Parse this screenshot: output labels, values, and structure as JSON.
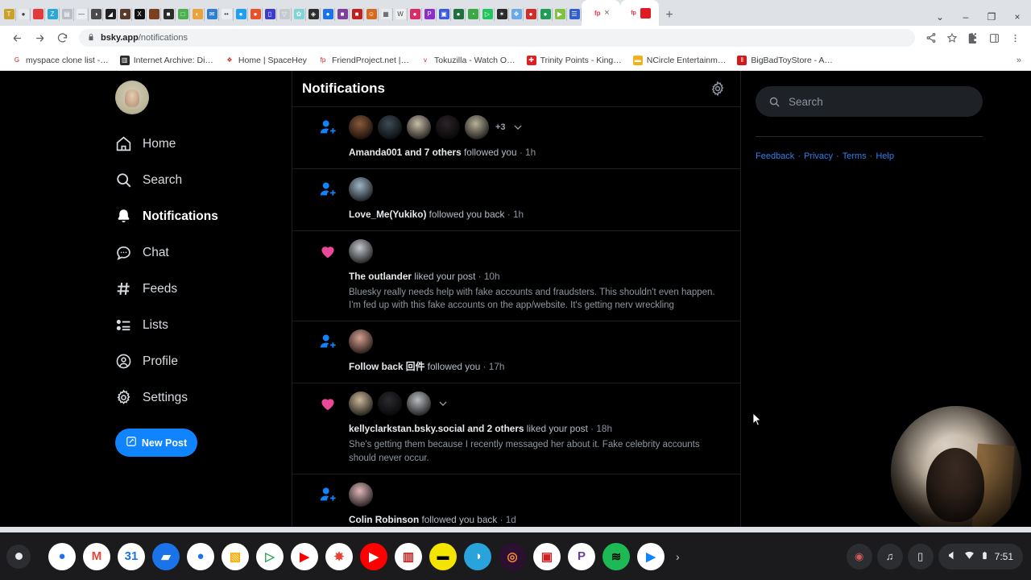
{
  "browser": {
    "url_host": "bsky.app",
    "url_path": "/notifications",
    "lock_icon": "lock-icon",
    "back_icon": "back-arrow-icon",
    "forward_icon": "forward-arrow-icon",
    "reload_icon": "reload-icon",
    "share_icon": "share-icon",
    "bookmark_icon": "star-icon",
    "extensions_icon": "puzzle-piece-icon",
    "sidepanel_icon": "side-panel-icon",
    "menu_icon": "three-dot-menu-icon",
    "newtab_label": "+",
    "tabsearch_label": "⌄",
    "minimize_label": "–",
    "maximize_label": "❐",
    "close_label": "×",
    "activetab_close": "×",
    "tab_favicons": [
      {
        "name": "tab-1",
        "color": "#c9a227",
        "glyph": "T"
      },
      {
        "name": "tab-2",
        "color": "#e8eaed",
        "glyph": "●"
      },
      {
        "name": "tab-3",
        "color": "#e23b3b",
        "glyph": ""
      },
      {
        "name": "tab-4",
        "color": "#2aa7d4",
        "glyph": "Z"
      },
      {
        "name": "tab-5",
        "color": "#b9bdc4",
        "glyph": "▤"
      },
      {
        "name": "tab-6",
        "color": "#eceff1",
        "glyph": "—"
      },
      {
        "name": "tab-7",
        "color": "#4a4a4a",
        "glyph": "◑"
      },
      {
        "name": "tab-8",
        "color": "#1f1f1f",
        "glyph": "◢"
      },
      {
        "name": "tab-9",
        "color": "#5a3a2a",
        "glyph": "●"
      },
      {
        "name": "tab-10",
        "color": "#111111",
        "glyph": "X"
      },
      {
        "name": "tab-11",
        "color": "#7a4020",
        "glyph": ""
      },
      {
        "name": "tab-12",
        "color": "#2b2b2b",
        "glyph": "■"
      },
      {
        "name": "tab-13",
        "color": "#4caf50",
        "glyph": "□"
      },
      {
        "name": "tab-14",
        "color": "#e8a33d",
        "glyph": "◐"
      },
      {
        "name": "tab-15",
        "color": "#2f7fd1",
        "glyph": "✉"
      },
      {
        "name": "tab-16",
        "color": "#eceff1",
        "glyph": "••"
      },
      {
        "name": "tab-17",
        "color": "#1da0f2",
        "glyph": "●"
      },
      {
        "name": "tab-18",
        "color": "#e8522b",
        "glyph": "●"
      },
      {
        "name": "tab-19",
        "color": "#3b3bcc",
        "glyph": "▯"
      },
      {
        "name": "tab-20",
        "color": "#c5cad1",
        "glyph": "▽"
      },
      {
        "name": "tab-21",
        "color": "#7fd4d4",
        "glyph": "✿"
      },
      {
        "name": "tab-22",
        "color": "#2e2e2e",
        "glyph": "◈"
      },
      {
        "name": "tab-23",
        "color": "#1a73e8",
        "glyph": "●"
      },
      {
        "name": "tab-24",
        "color": "#7e3f9d",
        "glyph": "■"
      },
      {
        "name": "tab-25",
        "color": "#c02020",
        "glyph": "■"
      },
      {
        "name": "tab-26",
        "color": "#d46a1f",
        "glyph": "☺"
      },
      {
        "name": "tab-27",
        "color": "#e8eaed",
        "glyph": "▦"
      },
      {
        "name": "tab-28",
        "color": "#f0f0f0",
        "glyph": "W"
      },
      {
        "name": "tab-29",
        "color": "#d92b6a",
        "glyph": "●"
      },
      {
        "name": "tab-30",
        "color": "#8b2fc9",
        "glyph": "P"
      },
      {
        "name": "tab-31",
        "color": "#3b5bdb",
        "glyph": "▣"
      },
      {
        "name": "tab-32",
        "color": "#1f6f3f",
        "glyph": "●"
      },
      {
        "name": "tab-33",
        "color": "#39a845",
        "glyph": "◔"
      },
      {
        "name": "tab-34",
        "color": "#22c55e",
        "glyph": "▷"
      },
      {
        "name": "tab-35",
        "color": "#2b2b2b",
        "glyph": "✶"
      },
      {
        "name": "tab-36",
        "color": "#6aa9e9",
        "glyph": "❖"
      },
      {
        "name": "tab-37",
        "color": "#d12b2b",
        "glyph": "●"
      },
      {
        "name": "tab-38",
        "color": "#1f9d55",
        "glyph": "●"
      },
      {
        "name": "tab-39",
        "color": "#7fc241",
        "glyph": "▶"
      },
      {
        "name": "tab-40",
        "color": "#2f5fd1",
        "glyph": "☰"
      }
    ],
    "active_tab_favicon": {
      "name": "friendproject-favicon",
      "color": "#e8344e",
      "glyph": "fp"
    },
    "active_tab_favicon2": {
      "name": "bluesky-tab-favicon",
      "color": "#e01b24",
      "glyph": "□"
    },
    "bookmarks": [
      {
        "name": "bookmark-myspace-clone-list",
        "label": "myspace clone list -…",
        "color": "#ffffff",
        "glyph": "G"
      },
      {
        "name": "bookmark-internet-archive",
        "label": "Internet Archive: Di…",
        "color": "#2b2b2b",
        "glyph": "▥"
      },
      {
        "name": "bookmark-spacehey",
        "label": "Home | SpaceHey",
        "color": "#ffffff",
        "glyph": "❖"
      },
      {
        "name": "bookmark-friendproject",
        "label": "FriendProject.net |…",
        "color": "#ffffff",
        "glyph": "fp"
      },
      {
        "name": "bookmark-tokuzilla",
        "label": "Tokuzilla - Watch O…",
        "color": "#ffffff",
        "glyph": "ᴠ"
      },
      {
        "name": "bookmark-trinity-points",
        "label": "Trinity Points - King…",
        "color": "#e02020",
        "glyph": "✚"
      },
      {
        "name": "bookmark-ncircle",
        "label": "NCircle Entertainm…",
        "color": "#f2b01e",
        "glyph": "▬"
      },
      {
        "name": "bookmark-bigbadtoystore",
        "label": "BigBadToyStore - A…",
        "color": "#cf1b1b",
        "glyph": "‖"
      }
    ],
    "bookmarks_overflow": "»"
  },
  "sidebar": {
    "avatar_name": "profile-avatar",
    "items": [
      {
        "label": "Home",
        "icon": "home-icon",
        "active": false
      },
      {
        "label": "Search",
        "icon": "search-icon",
        "active": false
      },
      {
        "label": "Notifications",
        "icon": "bell-icon",
        "active": true
      },
      {
        "label": "Chat",
        "icon": "chat-bubble-icon",
        "active": false
      },
      {
        "label": "Feeds",
        "icon": "hashtag-icon",
        "active": false
      },
      {
        "label": "Lists",
        "icon": "list-icon",
        "active": false
      },
      {
        "label": "Profile",
        "icon": "user-circle-icon",
        "active": false
      },
      {
        "label": "Settings",
        "icon": "gear-icon",
        "active": false
      }
    ],
    "new_post_label": "New Post",
    "new_post_icon": "compose-pencil-icon",
    "accent_color": "#1083fe"
  },
  "feed": {
    "title": "Notifications",
    "settings_icon": "notification-settings-gear-icon",
    "notifications": [
      {
        "id": "notif-1",
        "type": "follow",
        "icon": "follow-person-plus-icon",
        "icon_color": "#1083fe",
        "avatars": [
          "#8a5a3a",
          "#3d4b55",
          "#c9bda8",
          "#2a2328",
          "#b8b09a"
        ],
        "overflow_count": "+3",
        "chevron": "chevron-down-icon",
        "actor": "Amanda001",
        "others": "and 7 others",
        "action": "followed you",
        "timestamp": "1h",
        "body": ""
      },
      {
        "id": "notif-2",
        "type": "follow",
        "icon": "follow-person-plus-icon",
        "icon_color": "#1083fe",
        "avatars": [
          "#9fb4c6"
        ],
        "overflow_count": "",
        "chevron": "",
        "actor": "Love_Me(Yukiko)",
        "others": "",
        "action": "followed you back",
        "timestamp": "1h",
        "body": ""
      },
      {
        "id": "notif-3",
        "type": "like",
        "icon": "heart-icon",
        "icon_color": "#ec4899",
        "avatars": [
          "#c3c7cc"
        ],
        "overflow_count": "",
        "chevron": "",
        "actor": "The outlander",
        "others": "",
        "action": "liked your post",
        "timestamp": "10h",
        "body": "Bluesky really needs help with fake accounts and fraudsters. This shouldn't even happen. I'm fed up with this fake accounts on the app/website. It's getting nerv wreckling"
      },
      {
        "id": "notif-4",
        "type": "follow",
        "icon": "follow-person-plus-icon",
        "icon_color": "#1083fe",
        "avatars": [
          "#d6a090"
        ],
        "overflow_count": "",
        "chevron": "",
        "actor": "Follow back 回件",
        "others": "",
        "action": "followed you",
        "timestamp": "17h",
        "body": ""
      },
      {
        "id": "notif-5",
        "type": "like",
        "icon": "heart-icon",
        "icon_color": "#ec4899",
        "avatars": [
          "#cbb89a",
          "#2b2b30",
          "#b9bcc0"
        ],
        "overflow_count": "",
        "chevron": "chevron-down-icon",
        "actor": "kellyclarkstan.bsky.social",
        "others": "and 2 others",
        "action": "liked your post",
        "timestamp": "18h",
        "body": "She's getting them because I recently messaged her about it. Fake celebrity accounts should never occur."
      },
      {
        "id": "notif-6",
        "type": "follow",
        "icon": "follow-person-plus-icon",
        "icon_color": "#1083fe",
        "avatars": [
          "#e0b8bc"
        ],
        "overflow_count": "",
        "chevron": "",
        "actor": "Colin Robinson",
        "others": "",
        "action": "followed you back",
        "timestamp": "1d",
        "body": ""
      }
    ]
  },
  "rightbar": {
    "search_placeholder": "Search",
    "search_value": "",
    "search_icon": "search-icon",
    "footer_links": [
      "Feedback",
      "Privacy",
      "Terms",
      "Help"
    ],
    "footer_separator": "·",
    "link_color": "#2f80ed"
  },
  "webcam": {
    "name": "webcam-overlay"
  },
  "shelf": {
    "launcher_icon": "launcher-circle-icon",
    "expand_icon": "shelf-expand-chevron-icon",
    "clock": "7:51",
    "apps": [
      {
        "name": "shelf-app-chrome",
        "glyph": "●",
        "color": "#ffffff",
        "fg": "#1a73e8",
        "running": true
      },
      {
        "name": "shelf-app-gmail",
        "glyph": "M",
        "color": "#ffffff",
        "fg": "#ea4335",
        "running": false
      },
      {
        "name": "shelf-app-calendar",
        "glyph": "31",
        "color": "#ffffff",
        "fg": "#1a73e8",
        "running": false
      },
      {
        "name": "shelf-app-files",
        "glyph": "▰",
        "color": "#1a73e8",
        "fg": "#ffffff",
        "running": false
      },
      {
        "name": "shelf-app-messages",
        "glyph": "●",
        "color": "#ffffff",
        "fg": "#1a73e8",
        "running": false
      },
      {
        "name": "shelf-app-slides",
        "glyph": "▧",
        "color": "#ffffff",
        "fg": "#f9ab00",
        "running": false
      },
      {
        "name": "shelf-app-play-store",
        "glyph": "▷",
        "color": "#ffffff",
        "fg": "#34a853",
        "running": false
      },
      {
        "name": "shelf-app-youtube",
        "glyph": "▶",
        "color": "#ffffff",
        "fg": "#ff0000",
        "running": false
      },
      {
        "name": "shelf-app-photos",
        "glyph": "✸",
        "color": "#ffffff",
        "fg": "#ea4335",
        "running": false
      },
      {
        "name": "shelf-app-youtube-music",
        "glyph": "▶",
        "color": "#ff0000",
        "fg": "#ffffff",
        "running": false
      },
      {
        "name": "shelf-app-comics",
        "glyph": "▥",
        "color": "#ffffff",
        "fg": "#c02020",
        "running": false
      },
      {
        "name": "shelf-app-batman",
        "glyph": "▬",
        "color": "#f5e400",
        "fg": "#000000",
        "running": false
      },
      {
        "name": "shelf-app-browser-alt",
        "glyph": "◑",
        "color": "#29a3dc",
        "fg": "#ffffff",
        "running": false
      },
      {
        "name": "shelf-app-podcast",
        "glyph": "◎",
        "color": "#2b1030",
        "fg": "#ff8a3d",
        "running": false
      },
      {
        "name": "shelf-app-radio",
        "glyph": "▣",
        "color": "#ffffff",
        "fg": "#d02020",
        "running": false
      },
      {
        "name": "shelf-app-pandora",
        "glyph": "P",
        "color": "#ffffff",
        "fg": "#6b3fa0",
        "running": false
      },
      {
        "name": "shelf-app-spotify",
        "glyph": "≋",
        "color": "#1db954",
        "fg": "#000000",
        "running": false
      },
      {
        "name": "shelf-app-bluesky",
        "glyph": "▶",
        "color": "#ffffff",
        "fg": "#1083fe",
        "running": false
      }
    ],
    "tray_icons": [
      {
        "name": "screen-record-icon",
        "glyph": "◉",
        "color": "#d05a5a"
      },
      {
        "name": "media-controls-icon",
        "glyph": "♫",
        "color": "#e8eaed"
      },
      {
        "name": "phone-hub-icon",
        "glyph": "▯",
        "color": "#e8eaed"
      }
    ],
    "status_icons": [
      {
        "name": "volume-icon",
        "glyph": "◐"
      },
      {
        "name": "wifi-icon",
        "glyph": "▲"
      },
      {
        "name": "battery-icon",
        "glyph": "▮"
      }
    ]
  }
}
